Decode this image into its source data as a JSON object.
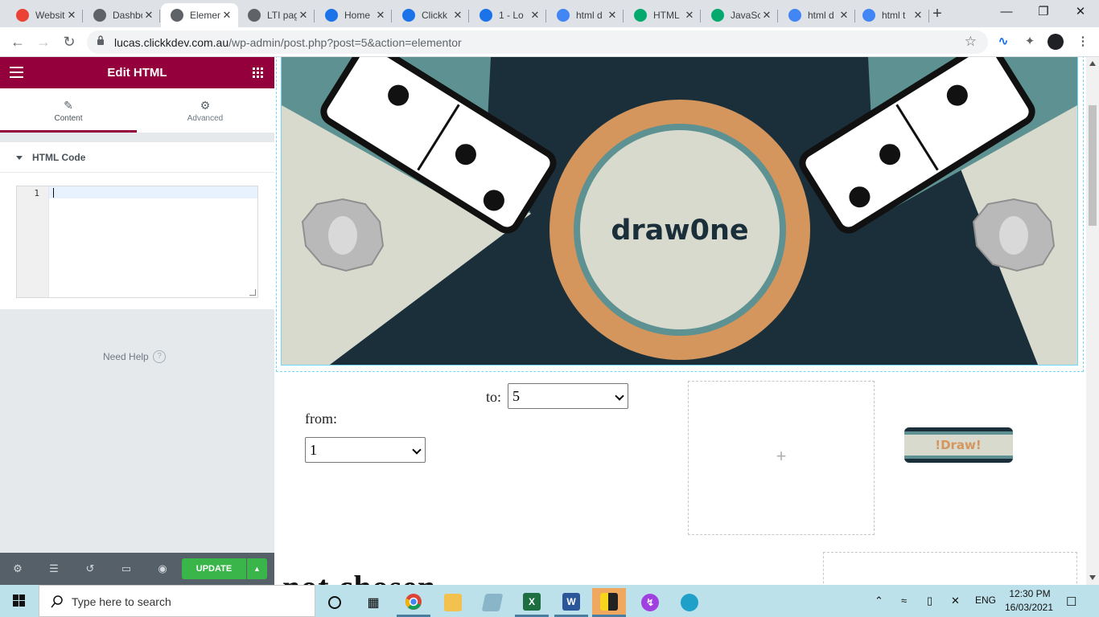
{
  "browser": {
    "tabs": [
      {
        "title": "Website",
        "icon": "gmail-icon",
        "color": "#ea4335"
      },
      {
        "title": "Dashboard",
        "icon": "globe-icon",
        "color": "#5f6368"
      },
      {
        "title": "Elementor",
        "icon": "globe-icon",
        "color": "#5f6368",
        "active": true
      },
      {
        "title": "LTI pages",
        "icon": "globe-icon",
        "color": "#5f6368"
      },
      {
        "title": "Home",
        "icon": "clickk-icon",
        "color": "#1a73e8"
      },
      {
        "title": "Clickk",
        "icon": "clickk-icon",
        "color": "#1a73e8"
      },
      {
        "title": "1 - Lo",
        "icon": "clickk-icon",
        "color": "#1a73e8"
      },
      {
        "title": "html d",
        "icon": "google-icon",
        "color": "#4285f4"
      },
      {
        "title": "HTML",
        "icon": "w3schools-icon",
        "color": "#04aa6d"
      },
      {
        "title": "JavaSc",
        "icon": "w3schools-icon",
        "color": "#04aa6d"
      },
      {
        "title": "html d",
        "icon": "google-icon",
        "color": "#4285f4"
      },
      {
        "title": "html t",
        "icon": "google-icon",
        "color": "#4285f4"
      }
    ],
    "url_host": "lucas.clickkdev.com.au",
    "url_path": "/wp-admin/post.php?post=5&action=elementor"
  },
  "panel": {
    "title": "Edit HTML",
    "tab_content": "Content",
    "tab_advanced": "Advanced",
    "section_title": "HTML Code",
    "line_number": "1",
    "need_help": "Need Help",
    "help_glyph": "?",
    "update_label": "UPDATE"
  },
  "preview": {
    "logo_text": "draw0ne",
    "to_label": "to:",
    "to_value": "5",
    "from_label": "from:",
    "from_value": "1",
    "draw_button": "!Draw!",
    "add_plus": "+",
    "partial_heading": "not chosen"
  },
  "taskbar": {
    "search_placeholder": "Type here to search",
    "time": "12:30 PM",
    "date": "16/03/2021",
    "lang": "ENG"
  },
  "colors": {
    "elementor_accent": "#93003c",
    "update_green": "#39b54a",
    "hero_teal": "#5e9191",
    "hero_navy": "#1b2f3b",
    "logo_orange": "#d4965c"
  }
}
